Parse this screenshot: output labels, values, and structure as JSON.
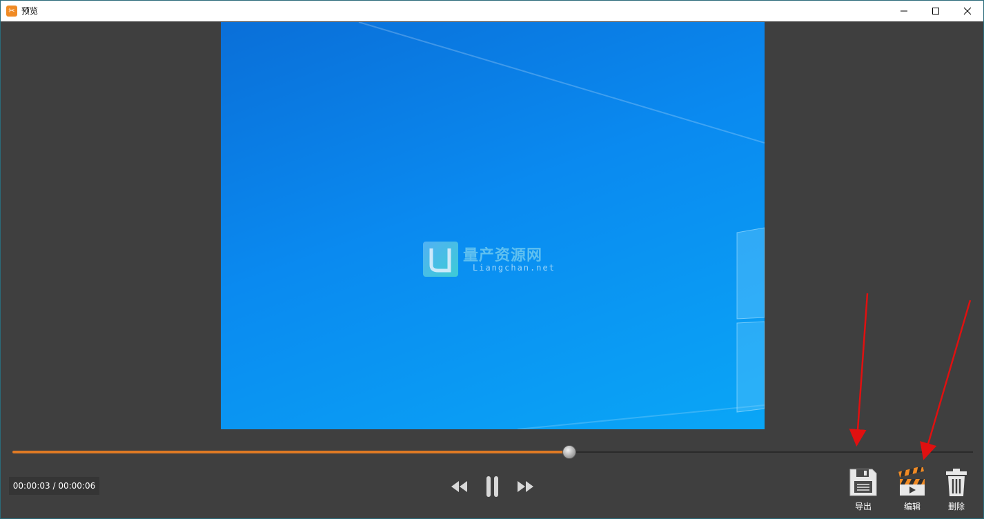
{
  "window": {
    "title": "预览"
  },
  "watermark": {
    "name_cn": "量产资源网",
    "name_en": "Liangchan.net"
  },
  "player": {
    "current_time": "00:00:03",
    "separator": "/",
    "total_time": "00:00:06",
    "progress": 0.58,
    "colors": {
      "progress_fill": "#e07a24",
      "track": "#2a2a2a"
    }
  },
  "controls": {
    "rewind_icon": "rewind-icon",
    "pause_icon": "pause-icon",
    "forward_icon": "fast-forward-icon"
  },
  "tools": {
    "export_label": "导出",
    "edit_label": "编辑",
    "delete_label": "删除"
  },
  "annotation_color": "#e01010"
}
